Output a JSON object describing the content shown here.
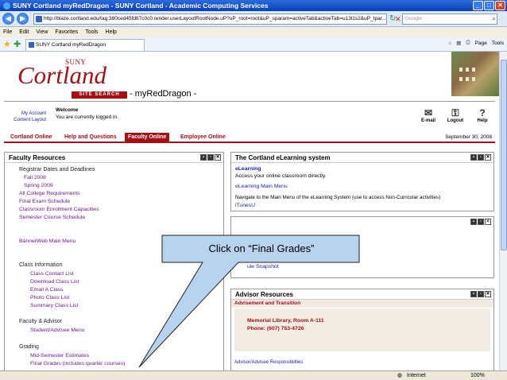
{
  "browser": {
    "window_title": "SUNY Cortland myRedDragon - SUNY Cortland - Academic Computing Services",
    "url": "http://blaze.cortland.edu/tag.380ced45fd87c0c0.render.userLayoutRootNode.uP?uP_root=root&uP_sparam=activeTab&activeTab=u13l1s2&uP_tpar...",
    "search_placeholder": "Google",
    "menu": [
      "File",
      "Edit",
      "View",
      "Favorites",
      "Tools",
      "Help"
    ],
    "tab_title": "SUNY Cortland myRedDragon",
    "toolbar_page": "Page",
    "toolbar_tools": "Tools",
    "status_zone": "Internet",
    "zoom": "100%"
  },
  "header": {
    "logo_suny": "SUNY",
    "logo_name": "Cortland",
    "site_search": "SITE SEARCH",
    "site_title": "- myRedDragon -",
    "my_account": "My Account",
    "content_layout": "Content Layout",
    "welcome_title": "Welcome",
    "welcome_text": "You are currently logged in.",
    "icons": [
      {
        "label": "E-mail",
        "icon": "email-icon"
      },
      {
        "label": "Logout",
        "icon": "key-icon"
      },
      {
        "label": "Help",
        "icon": "help-icon"
      }
    ]
  },
  "nav": {
    "tabs": [
      "Cortland Online",
      "Help and Questions",
      "Faculty Online",
      "Employee Online"
    ],
    "active_tab": "Faculty Online",
    "date": "September 30, 2008"
  },
  "faculty_resources": {
    "title": "Faculty Resources",
    "registrar": "Registrar Dates and Deadlines",
    "fall": "Fall 2008",
    "spring": "Spring 2009",
    "links1": [
      "All College Requirements",
      "Final Exam Schedule",
      "Classroom Enrollment Capacities",
      "Semester Course Schedule"
    ],
    "bannerweb": "BannerWeb Main Menu",
    "class_info": "Class Information",
    "class_links": [
      "Class Contact List",
      "Download Class List",
      "Email A Class",
      "Photo Class List",
      "Summary Class List"
    ],
    "faculty_advisor": "Faculty & Advisor",
    "advisee_menu": "Student/Advisee Menu",
    "grading": "Grading",
    "grading_links": [
      "Mid-Semester Estimates",
      "Final Grades (includes quarter courses)"
    ]
  },
  "elearning": {
    "title": "The Cortland eLearning system",
    "link": "eLearning",
    "desc": "Access your online classroom directly.",
    "main_menu": "eLearning Main Menu",
    "navigate": "Navigate to the Main Menu of the eLearning System (use to access Non-Curricular activities)",
    "itunes": "iTunesU"
  },
  "snapshot": {
    "link_partial": "ule Snapshot"
  },
  "advisor": {
    "title": "Advisor Resources",
    "sub": "Advisement and Transition",
    "location": "Memorial Library, Room A-111",
    "phone": "Phone: (607) 753-4726",
    "responsibilities": "Advisor/Advisee Responsibilities"
  },
  "callout": {
    "text": "Click on “Final Grades”"
  }
}
